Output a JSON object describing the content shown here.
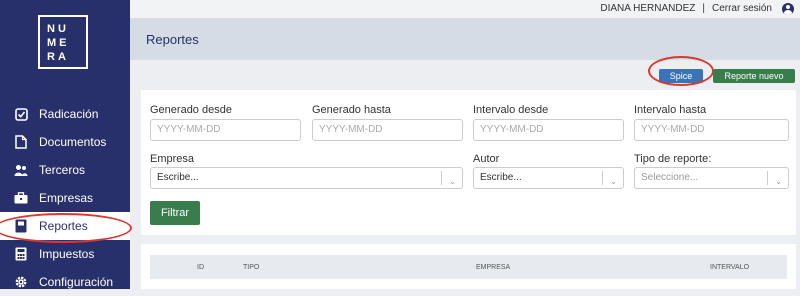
{
  "app": {
    "logo_lines": [
      "NU",
      "ME",
      "RA"
    ]
  },
  "sidebar": {
    "items": [
      {
        "label": "Radicación",
        "icon": "checkbox-icon"
      },
      {
        "label": "Documentos",
        "icon": "document-icon"
      },
      {
        "label": "Terceros",
        "icon": "users-icon"
      },
      {
        "label": "Empresas",
        "icon": "briefcase-icon"
      },
      {
        "label": "Reportes",
        "icon": "report-icon",
        "active": true
      },
      {
        "label": "Impuestos",
        "icon": "calculator-icon"
      },
      {
        "label": "Configuración",
        "icon": "gear-icon"
      }
    ]
  },
  "topbar": {
    "user_name": "DIANA HERNANDEZ",
    "separator": "|",
    "logout_label": "Cerrar sesión"
  },
  "page": {
    "title": "Reportes"
  },
  "actions": {
    "spice_label": "Spice",
    "new_report_label": "Reporte nuevo"
  },
  "filters": {
    "generado_desde": {
      "label": "Generado desde",
      "placeholder": "YYYY-MM-DD"
    },
    "generado_hasta": {
      "label": "Generado hasta",
      "placeholder": "YYYY-MM-DD"
    },
    "intervalo_desde": {
      "label": "Intervalo desde",
      "placeholder": "YYYY-MM-DD"
    },
    "intervalo_hasta": {
      "label": "Intervalo hasta",
      "placeholder": "YYYY-MM-DD"
    },
    "empresa": {
      "label": "Empresa",
      "value": "Escribe..."
    },
    "autor": {
      "label": "Autor",
      "value": "Escribe..."
    },
    "tipo_reporte": {
      "label": "Tipo de reporte:",
      "value": "Seleccione..."
    },
    "submit_label": "Filtrar"
  },
  "table": {
    "columns": [
      "ID",
      "TIPO",
      "EMPRESA",
      "INTERVALO"
    ]
  },
  "colors": {
    "sidebar_bg": "#27306b",
    "primary_green": "#3a7d4c",
    "spice_blue": "#3b73b9",
    "annotation_red": "#d83a2e"
  }
}
